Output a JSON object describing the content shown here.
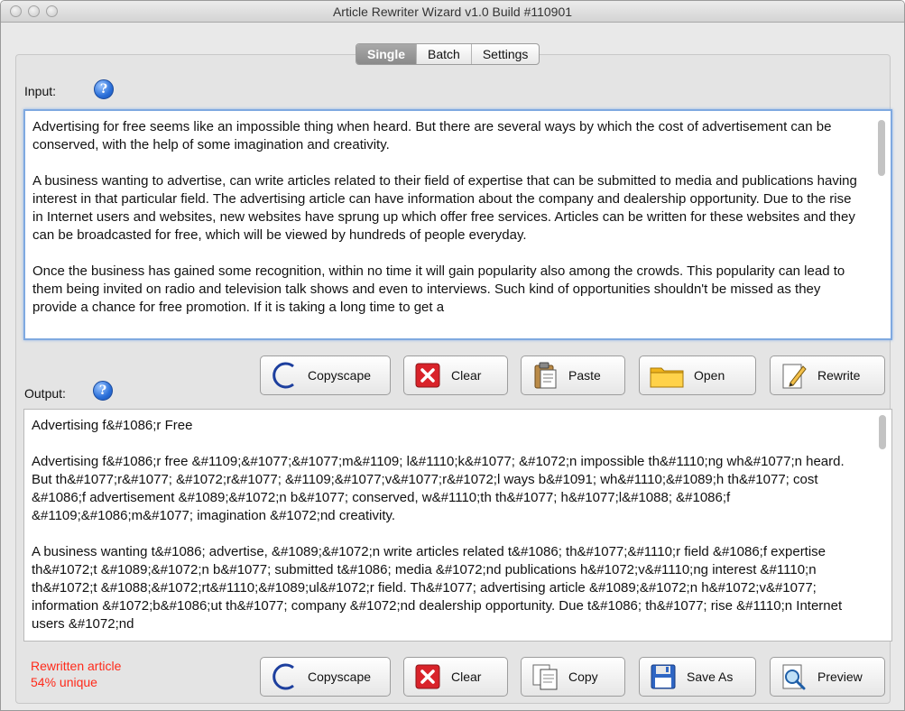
{
  "window": {
    "title": "Article Rewriter Wizard v1.0 Build #110901"
  },
  "tabs": [
    {
      "label": "Single",
      "active": true
    },
    {
      "label": "Batch",
      "active": false
    },
    {
      "label": "Settings",
      "active": false
    }
  ],
  "input": {
    "label": "Input:",
    "help_icon": "?",
    "paragraphs": [
      "Advertising for free seems like an impossible thing when heard. But there are several ways by which the cost of advertisement can be conserved, with the help of some imagination and creativity.",
      "A business wanting to advertise, can write articles related to their field of expertise that can be submitted to media and publications having interest in that particular field. The advertising article can have information about the company and dealership opportunity. Due to the rise in Internet users and websites, new websites have sprung up which offer free services. Articles can be written for these websites and they can be broadcasted for free, which will be viewed by hundreds of people everyday.",
      "Once the business has gained some recognition, within no time it will gain popularity also among the crowds. This popularity can lead to them being invited on radio and television talk shows and even to interviews. Such kind of opportunities shouldn't be missed as they provide a chance for free promotion. If it is taking a long time to get a"
    ]
  },
  "input_toolbar": {
    "copyscape": "Copyscape",
    "clear": "Clear",
    "paste": "Paste",
    "open": "Open",
    "rewrite": "Rewrite"
  },
  "output": {
    "label": "Output:",
    "help_icon": "?",
    "paragraphs": [
      "Advertising f&#1086;r Free",
      "Advertising f&#1086;r free &#1109;&#1077;&#1077;m&#1109; l&#1110;k&#1077; &#1072;n impossible th&#1110;ng wh&#1077;n heard. But th&#1077;r&#1077; &#1072;r&#1077; &#1109;&#1077;v&#1077;r&#1072;l ways b&#1091; wh&#1110;&#1089;h th&#1077; cost &#1086;f advertisement &#1089;&#1072;n b&#1077; conserved, w&#1110;th th&#1077; h&#1077;l&#1088; &#1086;f &#1109;&#1086;m&#1077; imagination &#1072;nd creativity.",
      "A business wanting t&#1086; advertise, &#1089;&#1072;n write articles related t&#1086; th&#1077;&#1110;r field &#1086;f expertise th&#1072;t &#1089;&#1072;n b&#1077; submitted t&#1086; media &#1072;nd publications h&#1072;v&#1110;ng interest &#1110;n th&#1072;t &#1088;&#1072;rt&#1110;&#1089;ul&#1072;r field. Th&#1077; advertising article &#1089;&#1072;n h&#1072;v&#1077; information &#1072;b&#1086;ut th&#1077; company &#1072;nd dealership opportunity. Due t&#1086; th&#1077; rise &#1110;n Internet users &#1072;nd"
    ]
  },
  "output_toolbar": {
    "copyscape": "Copyscape",
    "clear": "Clear",
    "copy": "Copy",
    "save_as": "Save As",
    "preview": "Preview"
  },
  "status": {
    "line1": "Rewritten article",
    "line2": "54% unique",
    "color": "#ff2a1a"
  }
}
